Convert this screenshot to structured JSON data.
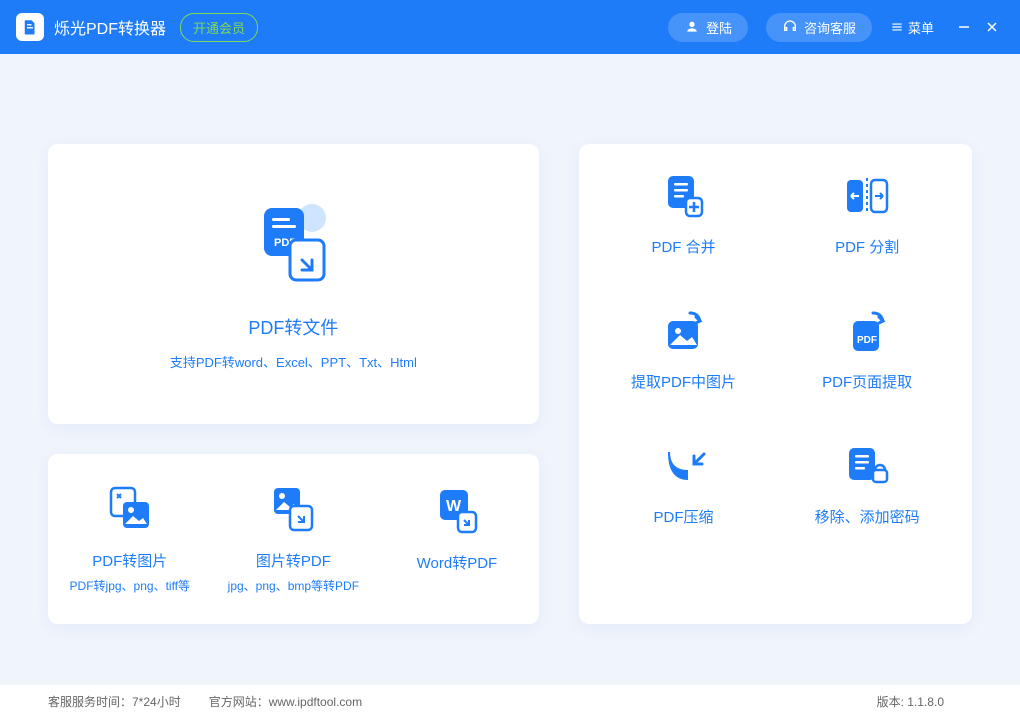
{
  "header": {
    "title": "烁光PDF转换器",
    "vip_label": "开通会员",
    "login_label": "登陆",
    "support_label": "咨询客服",
    "menu_label": "菜单"
  },
  "hero": {
    "title": "PDF转文件",
    "subtitle": "支持PDF转word、Excel、PPT、Txt、Html"
  },
  "small_cards": [
    {
      "title": "PDF转图片",
      "subtitle": "PDF转jpg、png、tiff等"
    },
    {
      "title": "图片转PDF",
      "subtitle": "jpg、png、bmp等转PDF"
    },
    {
      "title": "Word转PDF",
      "subtitle": ""
    }
  ],
  "grid_cards": [
    {
      "title": "PDF 合并"
    },
    {
      "title": "PDF 分割"
    },
    {
      "title": "提取PDF中图片"
    },
    {
      "title": "PDF页面提取"
    },
    {
      "title": "PDF压缩"
    },
    {
      "title": "移除、添加密码"
    }
  ],
  "footer": {
    "service_time": "客服服务时间：7*24小时",
    "website": "官方网站：www.ipdftool.com",
    "version": "版本: 1.1.8.0"
  }
}
